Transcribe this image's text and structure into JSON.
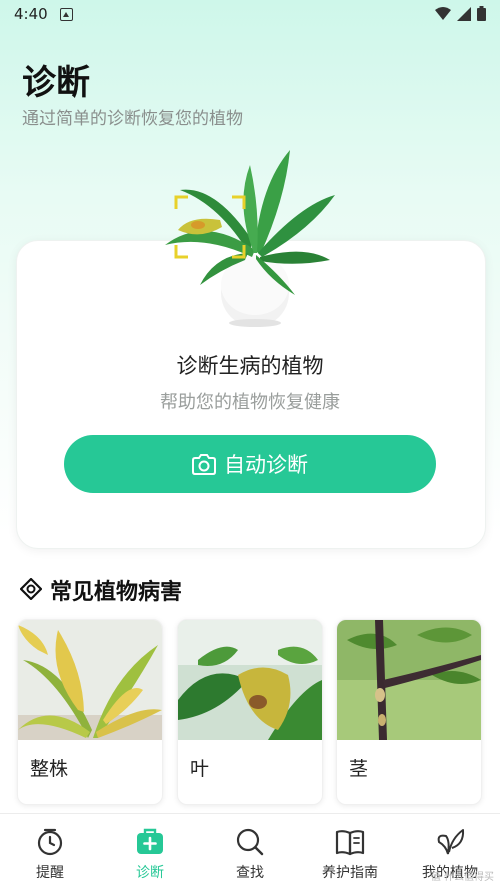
{
  "status_bar": {
    "time": "4:40"
  },
  "header": {
    "title": "诊断",
    "subtitle": "通过简单的诊断恢复您的植物"
  },
  "diagnose_card": {
    "title": "诊断生病的植物",
    "subtitle": "帮助您的植物恢复健康",
    "button_label": "自动诊断",
    "button_icon": "camera-icon"
  },
  "section": {
    "title": "常见植物病害",
    "icon": "target-icon"
  },
  "diseases": [
    {
      "label": "整株"
    },
    {
      "label": "叶"
    },
    {
      "label": "茎"
    }
  ],
  "nav": {
    "items": [
      {
        "label": "提醒",
        "icon": "clock-icon"
      },
      {
        "label": "诊断",
        "icon": "medical-kit-icon"
      },
      {
        "label": "查找",
        "icon": "search-icon"
      },
      {
        "label": "养护指南",
        "icon": "book-icon"
      },
      {
        "label": "我的植物",
        "icon": "leaf-icon"
      }
    ],
    "active_index": 1
  },
  "colors": {
    "accent": "#26c896",
    "title": "#111111",
    "subtitle": "#8a8f8d"
  },
  "watermark": "值 什么值得买"
}
